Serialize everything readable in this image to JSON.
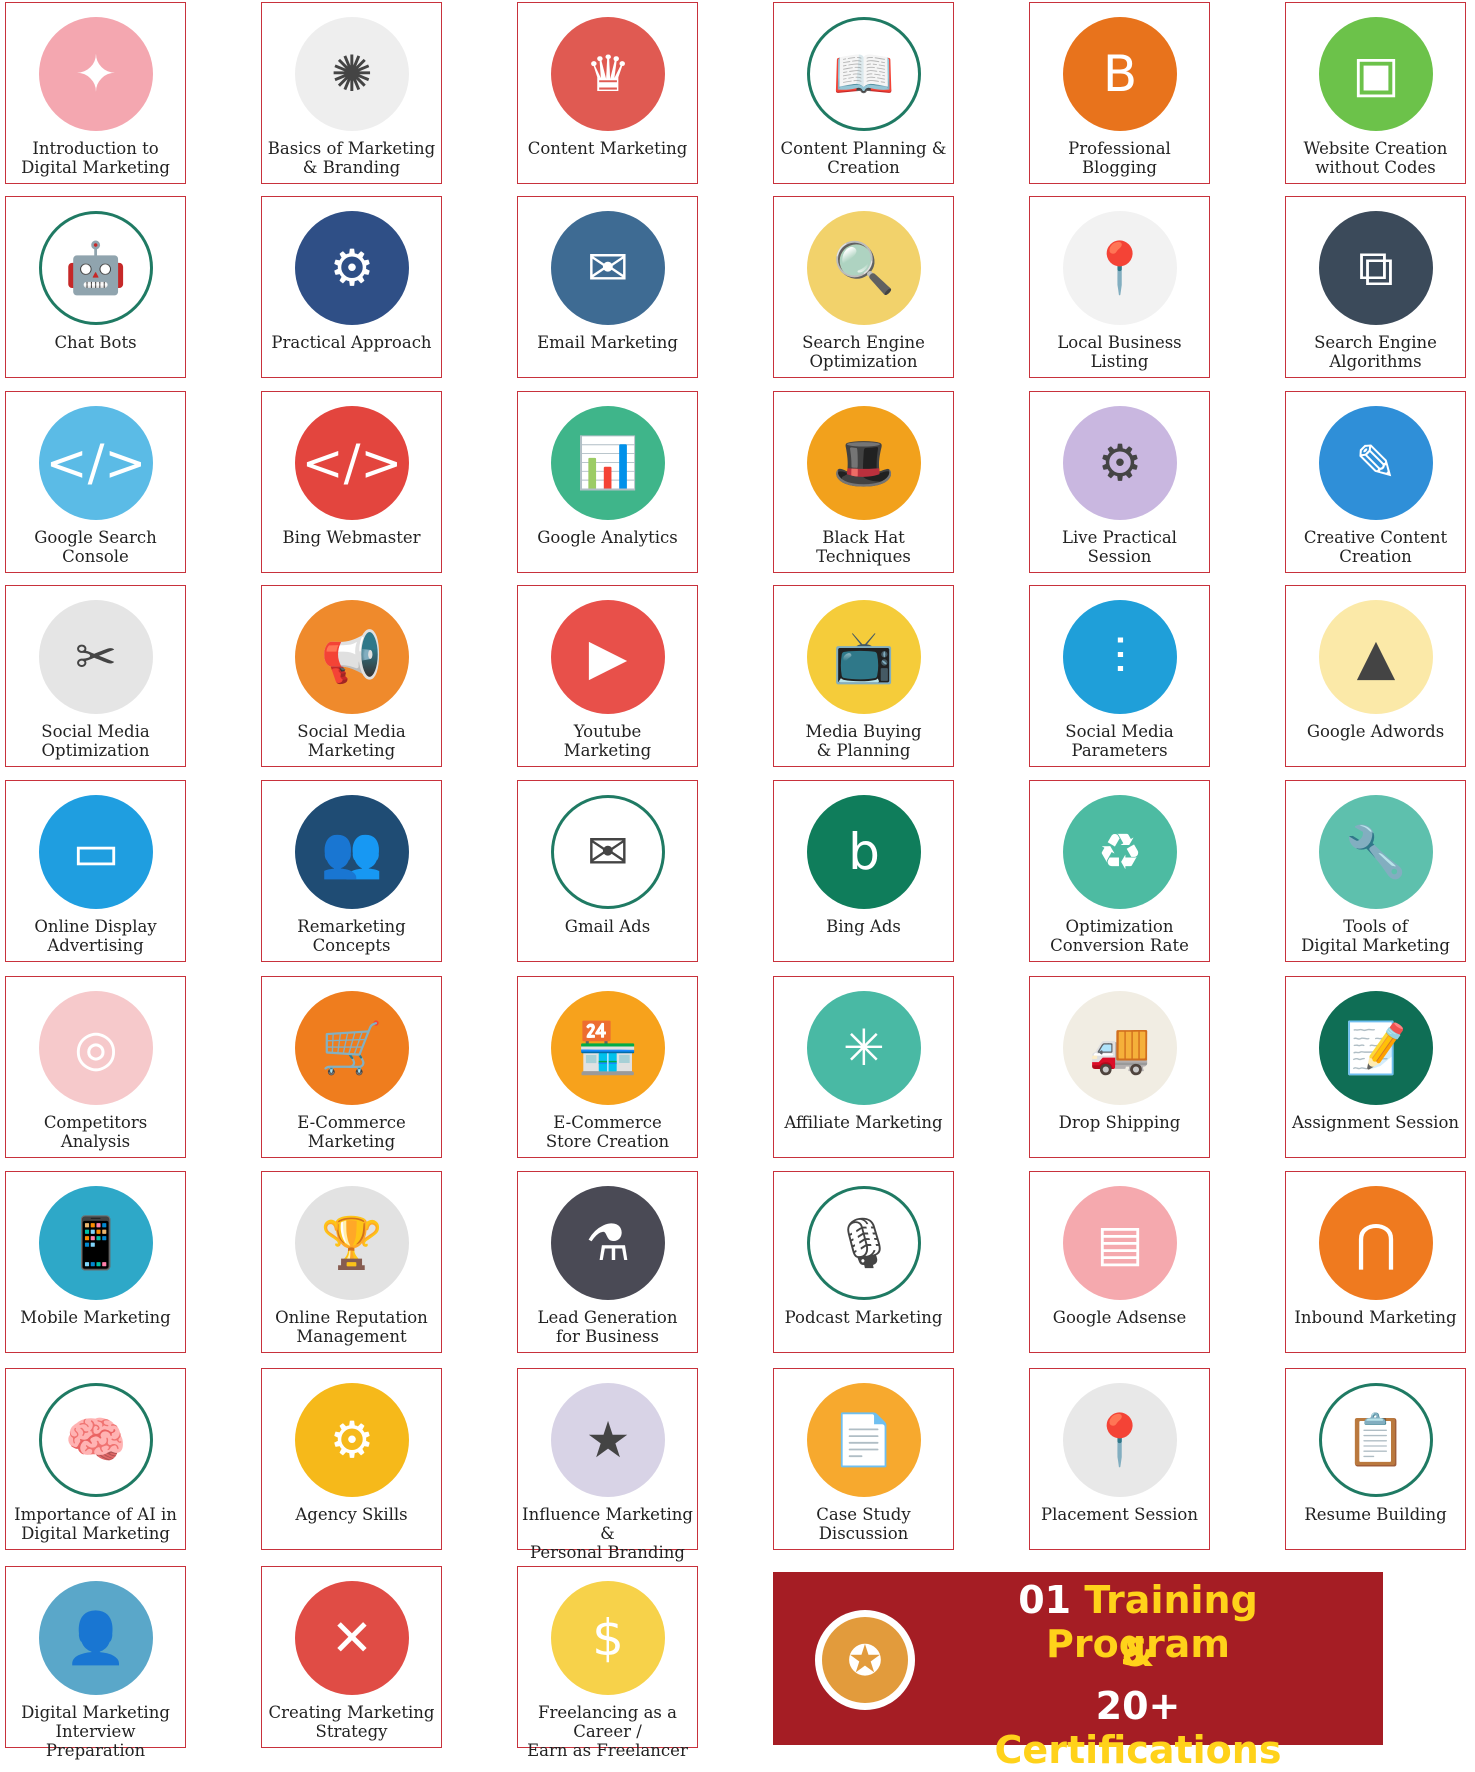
{
  "cards": [
    {
      "label": "Introduction to\nDigital Marketing",
      "icon": "digital-marketing-collage-icon",
      "color": "#f4a7b0",
      "glyph": "✦"
    },
    {
      "label": "Basics of Marketing\n& Branding",
      "icon": "branding-collage-icon",
      "color": "#eeeeee",
      "glyph": "✺"
    },
    {
      "label": "Content Marketing",
      "icon": "crown-document-icon",
      "color": "#e05a52",
      "glyph": "♛"
    },
    {
      "label": "Content Planning &\nCreation",
      "icon": "open-book-icon",
      "color": "#ffffff",
      "glyph": "📖"
    },
    {
      "label": "Professional Blogging",
      "icon": "blogger-logo-icon",
      "color": "#e8731c",
      "glyph": "B"
    },
    {
      "label": "Website Creation\nwithout Codes",
      "icon": "monitor-website-icon",
      "color": "#6cc24a",
      "glyph": "▣"
    },
    {
      "label": "Chat Bots",
      "icon": "robot-icon",
      "color": "#ffffff",
      "glyph": "🤖"
    },
    {
      "label": "Practical Approach",
      "icon": "team-workstation-icon",
      "color": "#2f4f86",
      "glyph": "⚙"
    },
    {
      "label": "Email Marketing",
      "icon": "envelope-icon",
      "color": "#3e6b93",
      "glyph": "✉"
    },
    {
      "label": "Search Engine\nOptimization",
      "icon": "seo-magnifier-icon",
      "color": "#f2d26b",
      "glyph": "🔍"
    },
    {
      "label": "Local Business\nListing",
      "icon": "map-pin-icon",
      "color": "#f2f2f2",
      "glyph": "📍"
    },
    {
      "label": "Search Engine\nAlgorithms",
      "icon": "algorithm-flowchart-icon",
      "color": "#3b4a5a",
      "glyph": "⧉"
    },
    {
      "label": "Google Search\nConsole",
      "icon": "code-monitor-icon",
      "color": "#5bbbe6",
      "glyph": "</>"
    },
    {
      "label": "Bing Webmaster",
      "icon": "code-window-icon",
      "color": "#e3453e",
      "glyph": "</>"
    },
    {
      "label": "Google Analytics",
      "icon": "analytics-magnifier-icon",
      "color": "#3fb58a",
      "glyph": "📊"
    },
    {
      "label": "Black Hat\nTechniques",
      "icon": "black-hat-icon",
      "color": "#f2a11c",
      "glyph": "🎩"
    },
    {
      "label": "Live Practical\nSession",
      "icon": "live-session-icon",
      "color": "#c9b7e0",
      "glyph": "⚙"
    },
    {
      "label": "Creative Content\nCreation",
      "icon": "browser-pencil-icon",
      "color": "#2f8fd8",
      "glyph": "✎"
    },
    {
      "label": "Social Media\nOptimization",
      "icon": "tools-network-icon",
      "color": "#e5e5e5",
      "glyph": "✂"
    },
    {
      "label": "Social Media\nMarketing",
      "icon": "megaphone-icon",
      "color": "#ef8a2c",
      "glyph": "📢"
    },
    {
      "label": "Youtube\nMarketing",
      "icon": "play-button-icon",
      "color": "#e8504a",
      "glyph": "▶"
    },
    {
      "label": "Media Buying\n& Planning",
      "icon": "television-icon",
      "color": "#f5cc3a",
      "glyph": "📺"
    },
    {
      "label": "Social Media\nParameters",
      "icon": "sliders-icon",
      "color": "#1f9fd9",
      "glyph": "⫶"
    },
    {
      "label": "Google Adwords",
      "icon": "google-ads-logo-icon",
      "color": "#fbe9a8",
      "glyph": "▲"
    },
    {
      "label": "Online Display\nAdvertising",
      "icon": "display-screen-icon",
      "color": "#1f9ee0",
      "glyph": "▭"
    },
    {
      "label": "Remarketing\nConcepts",
      "icon": "audience-cycle-icon",
      "color": "#1f4c74",
      "glyph": "👥"
    },
    {
      "label": "Gmail Ads",
      "icon": "gmail-logo-icon",
      "color": "#ffffff",
      "glyph": "✉"
    },
    {
      "label": "Bing Ads",
      "icon": "bing-logo-icon",
      "color": "#0f7d5b",
      "glyph": "b"
    },
    {
      "label": "Optimization\nConversion Rate",
      "icon": "recycle-arrows-icon",
      "color": "#4dbba2",
      "glyph": "♻"
    },
    {
      "label": "Tools of\nDigital Marketing",
      "icon": "wrench-screwdriver-icon",
      "color": "#5ec0ad",
      "glyph": "🔧"
    },
    {
      "label": "Competitors\nAnalysis",
      "icon": "radar-target-icon",
      "color": "#f6c9cb",
      "glyph": "◎"
    },
    {
      "label": "E-Commerce\nMarketing",
      "icon": "shopping-cart-icon",
      "color": "#ef7d1e",
      "glyph": "🛒"
    },
    {
      "label": "E-Commerce\nStore Creation",
      "icon": "storefront-icon",
      "color": "#f7a21c",
      "glyph": "🏪"
    },
    {
      "label": "Affiliate Marketing",
      "icon": "network-hub-icon",
      "color": "#49b9a4",
      "glyph": "✳"
    },
    {
      "label": "Drop Shipping",
      "icon": "delivery-truck-icon",
      "color": "#f1ede3",
      "glyph": "🚚"
    },
    {
      "label": "Assignment Session",
      "icon": "checklist-icon",
      "color": "#0f6e55",
      "glyph": "📝"
    },
    {
      "label": "Mobile Marketing",
      "icon": "smartphone-hand-icon",
      "color": "#2ea8c8",
      "glyph": "📱"
    },
    {
      "label": "Online Reputation\nManagement",
      "icon": "trophy-icon",
      "color": "#e2e2e2",
      "glyph": "🏆"
    },
    {
      "label": "Lead Generation\nfor Business",
      "icon": "flask-chart-icon",
      "color": "#4a4a55",
      "glyph": "⚗"
    },
    {
      "label": "Podcast Marketing",
      "icon": "microphone-headphones-icon",
      "color": "#ffffff",
      "glyph": "🎙"
    },
    {
      "label": "Google Adsense",
      "icon": "browser-ads-icon",
      "color": "#f5a9ae",
      "glyph": "▤"
    },
    {
      "label": "Inbound Marketing",
      "icon": "magnet-icon",
      "color": "#ef7a1f",
      "glyph": "⋂"
    },
    {
      "label": "Importance of AI in\nDigital Marketing",
      "icon": "ai-brain-icon",
      "color": "#ffffff",
      "glyph": "🧠"
    },
    {
      "label": "Agency Skills",
      "icon": "head-gears-icon",
      "color": "#f6b91a",
      "glyph": "⚙"
    },
    {
      "label": "Influence Marketing &\nPersonal Branding",
      "icon": "star-network-icon",
      "color": "#d8d3e6",
      "glyph": "★"
    },
    {
      "label": "Case Study\nDiscussion",
      "icon": "document-chart-icon",
      "color": "#f7a92e",
      "glyph": "📄"
    },
    {
      "label": "Placement Session",
      "icon": "person-location-icon",
      "color": "#e8e8e8",
      "glyph": "📍"
    },
    {
      "label": "Resume Building",
      "icon": "resume-search-icon",
      "color": "#ffffff",
      "glyph": "📋"
    },
    {
      "label": "Digital Marketing\nInterview Preparation",
      "icon": "interview-icon",
      "color": "#5aa7c9",
      "glyph": "👤"
    },
    {
      "label": "Creating Marketing\nStrategy",
      "icon": "strategy-board-icon",
      "color": "#e04c45",
      "glyph": "✕"
    },
    {
      "label": "Freelancing as a Career /\nEarn as Freelancer",
      "icon": "freelancer-money-icon",
      "color": "#f7d24a",
      "glyph": "$"
    }
  ],
  "banner": {
    "line1_num": "01",
    "line1_text": "Training Program",
    "amp": "&",
    "line2_num": "20+",
    "line2_text": "Certifications",
    "icon": "award-medal-icon",
    "medal_glyph": "✪",
    "bg": "#a51d24",
    "accent": "#ffd21a"
  }
}
